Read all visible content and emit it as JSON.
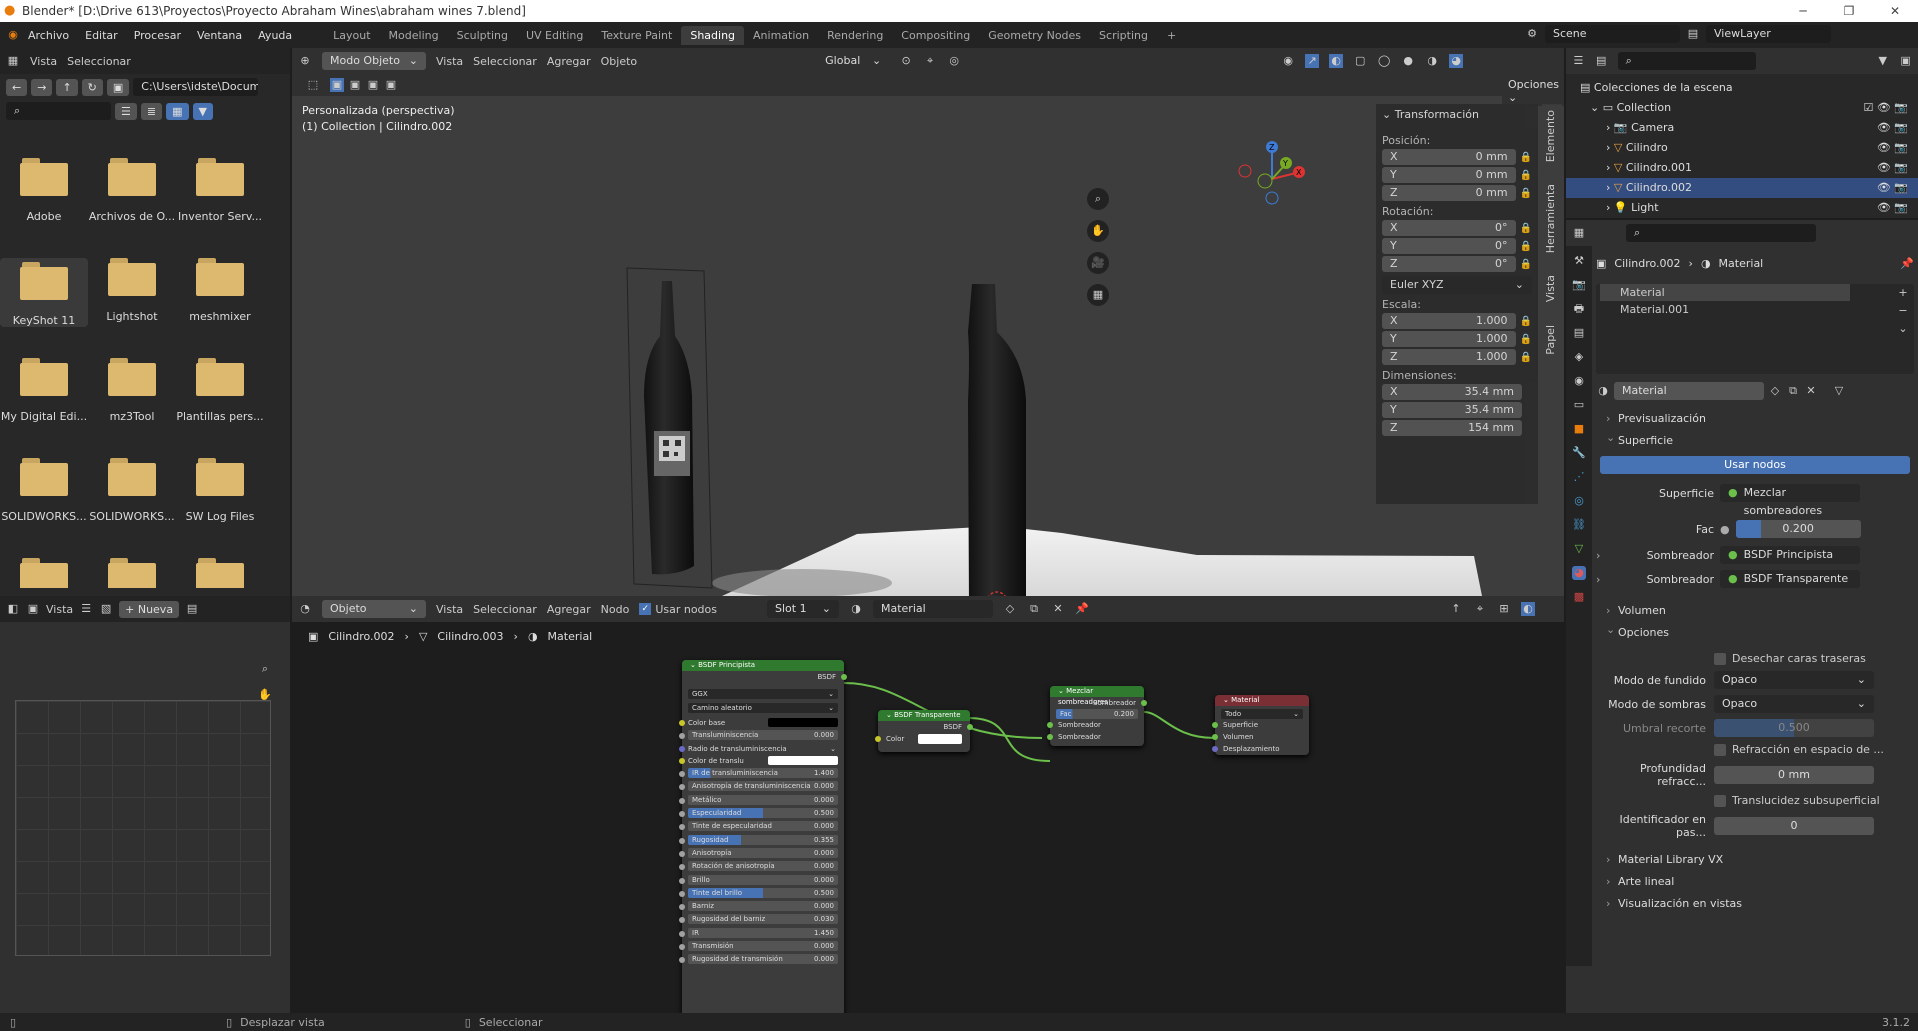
{
  "window": {
    "title": "Blender* [D:\\Drive 613\\Proyectos\\Proyecto Abraham Wines\\abraham wines 7.blend]"
  },
  "menu": [
    "Archivo",
    "Editar",
    "Procesar",
    "Ventana",
    "Ayuda"
  ],
  "workspaces": [
    "Layout",
    "Modeling",
    "Sculpting",
    "UV Editing",
    "Texture Paint",
    "Shading",
    "Animation",
    "Rendering",
    "Compositing",
    "Geometry Nodes",
    "Scripting"
  ],
  "active_workspace": "Shading",
  "scene": "Scene",
  "view_layer": "ViewLayer",
  "filebrowser": {
    "header": [
      "Vista",
      "Seleccionar"
    ],
    "path": "C:\\Users\\idste\\Docum...",
    "folders": [
      "Adobe",
      "Archivos de O...",
      "Inventor Serv...",
      "KeyShot 11",
      "Lightshot",
      "meshmixer",
      "My Digital Edi...",
      "mz3Tool",
      "Plantillas pers...",
      "SOLIDWORKS...",
      "SOLIDWORKS...",
      "SW Log Files"
    ]
  },
  "viewport": {
    "mode": "Modo Objeto",
    "menus": [
      "Vista",
      "Seleccionar",
      "Agregar",
      "Objeto"
    ],
    "orientation": "Global",
    "options": "Opciones",
    "info1": "Personalizada (perspectiva)",
    "info2": "(1) Collection | Cilindro.002",
    "gizmo": {
      "x": "X",
      "y": "Y",
      "z": "Z"
    },
    "tabs": [
      "Elemento",
      "Herramienta",
      "Vista",
      "Papel"
    ]
  },
  "transform": {
    "title": "Transformación",
    "position_label": "Posición:",
    "position": [
      {
        "axis": "X",
        "value": "0 mm"
      },
      {
        "axis": "Y",
        "value": "0 mm"
      },
      {
        "axis": "Z",
        "value": "0 mm"
      }
    ],
    "rotation_label": "Rotación:",
    "rotation": [
      {
        "axis": "X",
        "value": "0°"
      },
      {
        "axis": "Y",
        "value": "0°"
      },
      {
        "axis": "Z",
        "value": "0°"
      }
    ],
    "rotation_mode": "Euler XYZ",
    "scale_label": "Escala:",
    "scale": [
      {
        "axis": "X",
        "value": "1.000"
      },
      {
        "axis": "Y",
        "value": "1.000"
      },
      {
        "axis": "Z",
        "value": "1.000"
      }
    ],
    "dimensions_label": "Dimensiones:",
    "dimensions": [
      {
        "axis": "X",
        "value": "35.4 mm"
      },
      {
        "axis": "Y",
        "value": "35.4 mm"
      },
      {
        "axis": "Z",
        "value": "154 mm"
      }
    ]
  },
  "outliner": {
    "root": "Colecciones de la escena",
    "collection": "Collection",
    "items": [
      "Camera",
      "Cilindro",
      "Cilindro.001",
      "Cilindro.002",
      "Light"
    ]
  },
  "properties": {
    "breadcrumb": [
      "Cilindro.002",
      "Material"
    ],
    "slots": [
      "Material",
      "Material.001"
    ],
    "material_name": "Material",
    "sections": {
      "preview": "Previsualización",
      "surface": "Superficie",
      "volume": "Volumen",
      "options": "Opciones",
      "matlib": "Material Library VX",
      "lineart": "Arte lineal",
      "viewport": "Visualización en vistas"
    },
    "use_nodes": "Usar nodos",
    "surface_label": "Superficie",
    "surface_value": "Mezclar sombreadores",
    "fac_label": "Fac",
    "fac_value": "0.200",
    "fac_fraction": 0.2,
    "shader1_label": "Sombreador",
    "shader1_value": "BSDF Principista",
    "shader2_label": "Sombreador",
    "shader2_value": "BSDF Transparente",
    "backface": "Desechar caras traseras",
    "blend_label": "Modo de fundido",
    "blend_value": "Opaco",
    "shadow_label": "Modo de sombras",
    "shadow_value": "Opaco",
    "clip_label": "Umbral recorte",
    "clip_value": "0.500",
    "refraction": "Refracción en espacio de ...",
    "depth_label": "Profundidad refracc...",
    "depth_value": "0 mm",
    "sss": "Translucidez subsuperficial",
    "passid_label": "Identificador en pas...",
    "passid_value": "0"
  },
  "imageeditor": {
    "view": "Vista",
    "new": "Nueva"
  },
  "nodeeditor": {
    "object": "Objeto",
    "menus": [
      "Vista",
      "Seleccionar",
      "Agregar",
      "Nodo"
    ],
    "use_nodes": "Usar nodos",
    "slot": "Slot 1",
    "material": "Material",
    "breadcrumb": [
      "Cilindro.002",
      "Cilindro.003",
      "Material"
    ]
  },
  "nodes": {
    "principled": {
      "title": "BSDF Principista",
      "out": "BSDF",
      "dist": "GGX",
      "sss_method": "Camino aleatorio",
      "rows": [
        {
          "label": "Color base",
          "value": "",
          "type": "color-dark"
        },
        {
          "label": "Transluminiscencia",
          "value": "0.000"
        },
        {
          "label": "Radio de transluminiscencia",
          "value": "",
          "type": "vec"
        },
        {
          "label": "Color de translu",
          "value": "",
          "type": "color-white"
        },
        {
          "label": "IR de transluminiscencia",
          "value": "1.400",
          "fill": 0.15
        },
        {
          "label": "Anisotropía de transluminiscencia",
          "value": "0.000"
        },
        {
          "label": "Metálico",
          "value": "0.000"
        },
        {
          "label": "Especularidad",
          "value": "0.500",
          "fill": 0.5
        },
        {
          "label": "Tinte de especularidad",
          "value": "0.000"
        },
        {
          "label": "Rugosidad",
          "value": "0.355",
          "fill": 0.355
        },
        {
          "label": "Anisotropía",
          "value": "0.000"
        },
        {
          "label": "Rotación de anisotropía",
          "value": "0.000"
        },
        {
          "label": "Brillo",
          "value": "0.000"
        },
        {
          "label": "Tinte del brillo",
          "value": "0.500",
          "fill": 0.5
        },
        {
          "label": "Barniz",
          "value": "0.000"
        },
        {
          "label": "Rugosidad del barniz",
          "value": "0.030"
        },
        {
          "label": "IR",
          "value": "1.450"
        },
        {
          "label": "Transmisión",
          "value": "0.000"
        },
        {
          "label": "Rugosidad de transmisión",
          "value": "0.000"
        }
      ]
    },
    "mix": {
      "title": "Mezclar sombreadores",
      "out": "Sombreador",
      "fac_label": "Fac",
      "fac_value": "0.200",
      "in1": "Sombreador",
      "in2": "Sombreador"
    },
    "output": {
      "title": "Material",
      "target": "Todo",
      "in1": "Superficie",
      "in2": "Volumen",
      "in3": "Desplazamiento"
    },
    "transparent": {
      "title": "BSDF Transparente",
      "out": "BSDF",
      "color_label": "Color"
    }
  },
  "status": {
    "left": "Desplazar vista",
    "mid": "Seleccionar",
    "version": "3.1.2"
  }
}
